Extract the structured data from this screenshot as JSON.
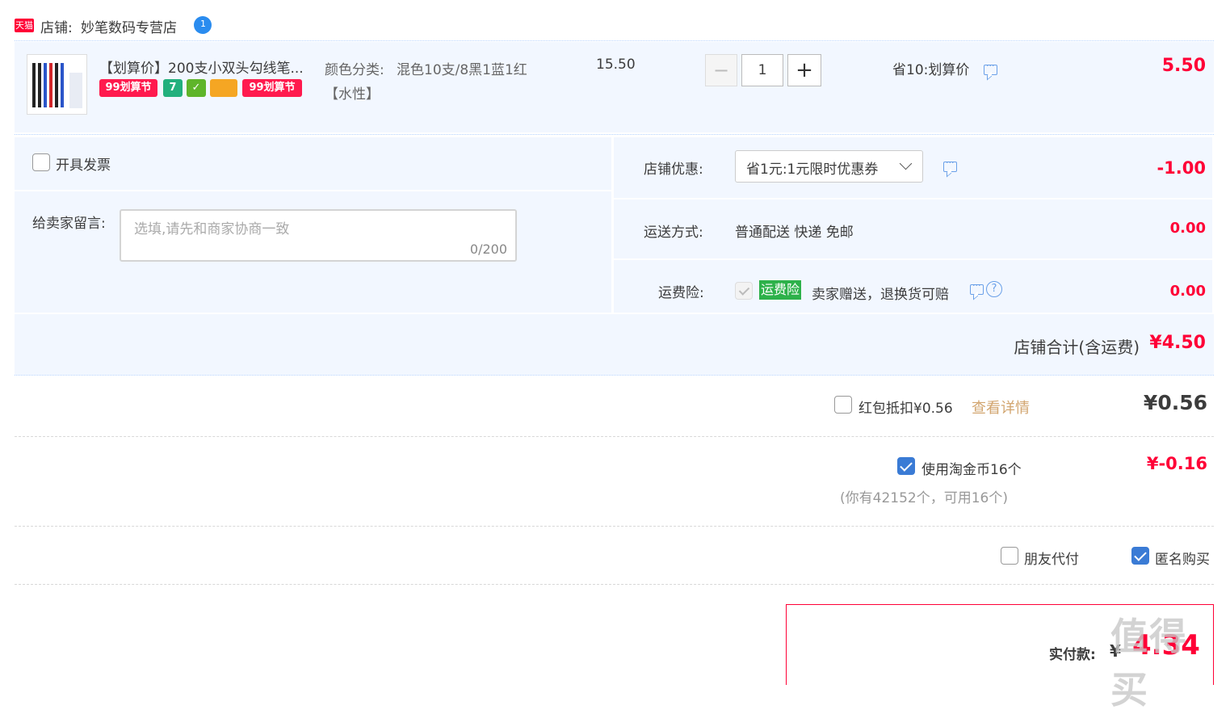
{
  "shop": {
    "badge": "天猫",
    "label": "店铺:",
    "name": "妙笔数码专营店"
  },
  "item": {
    "title": "【划算价】200支小双头勾线笔...",
    "tags": [
      "99划算节",
      "7",
      "",
      "",
      "99划算节"
    ],
    "sku_label": "颜色分类:",
    "sku_value": "混色10支/8黑1蓝1红",
    "sku_extra": "【水性】",
    "unit_price": "15.50",
    "qty_minus": "−",
    "qty_value": "1",
    "qty_plus": "+",
    "promo": "省10:划算价",
    "subtotal": "5.50"
  },
  "options": {
    "invoice_label": "开具发票",
    "note_label": "给卖家留言:",
    "note_placeholder": "选填,请先和商家协商一致",
    "note_count": "0/200"
  },
  "shop_discount": {
    "label": "店铺优惠:",
    "selected": "省1元:1元限时优惠券",
    "amount": "-1.00"
  },
  "shipping": {
    "label": "运送方式:",
    "value": "普通配送 快递 免邮",
    "amount": "0.00"
  },
  "insurance": {
    "label": "运费险:",
    "badge": "运费险",
    "desc": "卖家赠送，退换货可赔",
    "amount": "0.00"
  },
  "shop_total": {
    "label": "店铺合计(含运费)",
    "amount": "¥4.50"
  },
  "redpacket": {
    "label": "红包抵扣¥0.56",
    "link": "查看详情",
    "amount": "¥0.56"
  },
  "coins": {
    "label": "使用淘金币16个",
    "sub": "(你有42152个，可用16个)",
    "amount": "¥-0.16"
  },
  "extra": {
    "friend_pay": "朋友代付",
    "anonymous": "匿名购买"
  },
  "pay": {
    "label": "实付款:",
    "currency": "¥",
    "amount": "4.34"
  },
  "watermark": "值得买",
  "colors": {
    "accent": "#ff0036",
    "blue": "#3a7bd5",
    "bg_light": "#f2f7ff",
    "border_blue": "#b2d1ff",
    "green": "#2db14a"
  }
}
